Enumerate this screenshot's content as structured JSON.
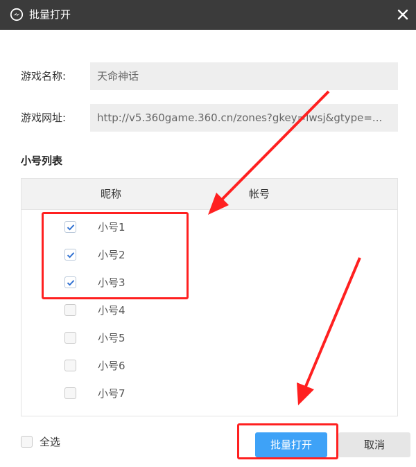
{
  "window": {
    "title": "批量打开",
    "logo_icon": "360-logo-icon",
    "close_icon": "close-icon"
  },
  "form": {
    "game_name_label": "游戏名称:",
    "game_name_value": "天命神话",
    "game_url_label": "游戏网址:",
    "game_url_value": "http://v5.360game.360.cn/zones?gkey=lwsj&gtype=..."
  },
  "accounts": {
    "section_title": "小号列表",
    "columns": [
      "昵称",
      "帐号"
    ],
    "rows": [
      {
        "nickname": "小号1",
        "account": "",
        "checked": true
      },
      {
        "nickname": "小号2",
        "account": "",
        "checked": true
      },
      {
        "nickname": "小号3",
        "account": "",
        "checked": true
      },
      {
        "nickname": "小号4",
        "account": "",
        "checked": false
      },
      {
        "nickname": "小号5",
        "account": "",
        "checked": false
      },
      {
        "nickname": "小号6",
        "account": "",
        "checked": false
      },
      {
        "nickname": "小号7",
        "account": "",
        "checked": false
      }
    ]
  },
  "footer": {
    "select_all_label": "全选",
    "select_all_checked": false,
    "open_button": "批量打开",
    "cancel_button": "取消"
  },
  "colors": {
    "titlebar": "#3b3b3b",
    "primary": "#3ea2f7",
    "checkmark": "#2d6fd1",
    "annotation": "#ff2020"
  }
}
